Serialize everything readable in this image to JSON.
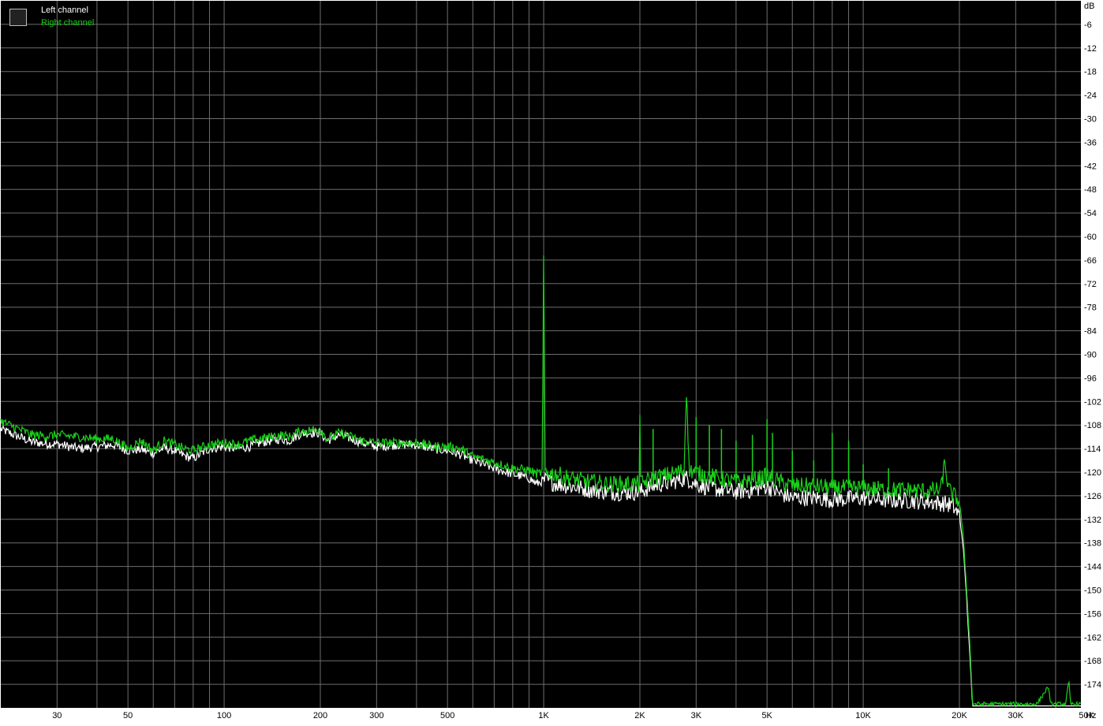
{
  "chart_data": {
    "type": "line",
    "x_axis": {
      "unit": "Hz",
      "scale": "log",
      "range": [
        20,
        48000
      ],
      "ticks": [
        {
          "value": 30,
          "label": "30"
        },
        {
          "value": 50,
          "label": "50"
        },
        {
          "value": 100,
          "label": "100"
        },
        {
          "value": 200,
          "label": "200"
        },
        {
          "value": 300,
          "label": "300"
        },
        {
          "value": 500,
          "label": "500"
        },
        {
          "value": 1000,
          "label": "1K"
        },
        {
          "value": 2000,
          "label": "2K"
        },
        {
          "value": 3000,
          "label": "3K"
        },
        {
          "value": 5000,
          "label": "5K"
        },
        {
          "value": 10000,
          "label": "10K"
        },
        {
          "value": 20000,
          "label": "20K"
        },
        {
          "value": 30000,
          "label": "30K"
        },
        {
          "value": 50000,
          "label": "50K"
        }
      ]
    },
    "y_axis": {
      "unit": "dB",
      "range": [
        -180,
        0
      ],
      "ticks": [
        -6,
        -12,
        -18,
        -24,
        -30,
        -36,
        -42,
        -48,
        -54,
        -60,
        -66,
        -72,
        -78,
        -84,
        -90,
        -96,
        -102,
        -108,
        -114,
        -120,
        -126,
        -132,
        -138,
        -144,
        -150,
        -156,
        -162,
        -168,
        -174
      ]
    },
    "grid": true,
    "legend_position": "top-left",
    "colors": {
      "background": "#000000",
      "grid": "#6e6e6e",
      "left": "#ffffff",
      "right": "#19d219",
      "axis_bg": "#ffffff"
    },
    "series": [
      {
        "name": "Left channel",
        "points": [
          [
            20,
            -109
          ],
          [
            22,
            -110.5
          ],
          [
            25,
            -112.3
          ],
          [
            28,
            -112.8
          ],
          [
            30,
            -112.8
          ],
          [
            35,
            -114
          ],
          [
            40,
            -113.5
          ],
          [
            45,
            -113
          ],
          [
            50,
            -114.5
          ],
          [
            55,
            -114.2
          ],
          [
            60,
            -115.2
          ],
          [
            65,
            -113.8
          ],
          [
            70,
            -114.5
          ],
          [
            75,
            -115.8
          ],
          [
            80,
            -116.5
          ],
          [
            90,
            -114
          ],
          [
            100,
            -113.5
          ],
          [
            110,
            -114
          ],
          [
            120,
            -113.5
          ],
          [
            130,
            -112.5
          ],
          [
            140,
            -112
          ],
          [
            150,
            -111.5
          ],
          [
            160,
            -112
          ],
          [
            170,
            -110.5
          ],
          [
            180,
            -110
          ],
          [
            200,
            -110
          ],
          [
            210,
            -112
          ],
          [
            230,
            -110.5
          ],
          [
            250,
            -111.5
          ],
          [
            270,
            -112.5
          ],
          [
            300,
            -113.5
          ],
          [
            350,
            -113
          ],
          [
            400,
            -113
          ],
          [
            450,
            -114
          ],
          [
            500,
            -114.5
          ],
          [
            550,
            -115.5
          ],
          [
            600,
            -117
          ],
          [
            700,
            -119
          ],
          [
            800,
            -120.5
          ],
          [
            900,
            -121.5
          ],
          [
            950,
            -123
          ],
          [
            1000,
            -122
          ],
          [
            1100,
            -123
          ],
          [
            1200,
            -123.5
          ],
          [
            1400,
            -124.5
          ],
          [
            1600,
            -125
          ],
          [
            1800,
            -125.2
          ],
          [
            2000,
            -125
          ],
          [
            2200,
            -123.5
          ],
          [
            2500,
            -122.5
          ],
          [
            2800,
            -121.5
          ],
          [
            3000,
            -123
          ],
          [
            3300,
            -124
          ],
          [
            3600,
            -124.5
          ],
          [
            4000,
            -125
          ],
          [
            4500,
            -124.5
          ],
          [
            5000,
            -123.5
          ],
          [
            5500,
            -125.5
          ],
          [
            6000,
            -126.5
          ],
          [
            7000,
            -126.5
          ],
          [
            8000,
            -127
          ],
          [
            9000,
            -126.8
          ],
          [
            10000,
            -126.5
          ],
          [
            12000,
            -127.2
          ],
          [
            14000,
            -127.2
          ],
          [
            16000,
            -127.5
          ],
          [
            18000,
            -128
          ],
          [
            19000,
            -128.5
          ],
          [
            20000,
            -131
          ],
          [
            20500,
            -138
          ],
          [
            21000,
            -150
          ],
          [
            21500,
            -165
          ],
          [
            22000,
            -180
          ],
          [
            48000,
            -180
          ]
        ]
      },
      {
        "name": "Right channel",
        "points": [
          [
            20,
            -107
          ],
          [
            22,
            -108.5
          ],
          [
            25,
            -110.5
          ],
          [
            28,
            -110.8
          ],
          [
            30,
            -110.5
          ],
          [
            35,
            -111
          ],
          [
            40,
            -111.5
          ],
          [
            45,
            -111.5
          ],
          [
            50,
            -114
          ],
          [
            55,
            -112
          ],
          [
            60,
            -114.5
          ],
          [
            65,
            -112
          ],
          [
            70,
            -113
          ],
          [
            75,
            -114
          ],
          [
            80,
            -114.5
          ],
          [
            90,
            -113
          ],
          [
            100,
            -112.5
          ],
          [
            110,
            -113
          ],
          [
            120,
            -112
          ],
          [
            130,
            -111.5
          ],
          [
            140,
            -111
          ],
          [
            150,
            -110.5
          ],
          [
            160,
            -111
          ],
          [
            170,
            -109.8
          ],
          [
            180,
            -109.5
          ],
          [
            200,
            -109
          ],
          [
            210,
            -111.5
          ],
          [
            230,
            -110
          ],
          [
            250,
            -111
          ],
          [
            270,
            -112
          ],
          [
            300,
            -112.5
          ],
          [
            350,
            -112.5
          ],
          [
            400,
            -112.5
          ],
          [
            450,
            -113.5
          ],
          [
            500,
            -113.5
          ],
          [
            550,
            -114
          ],
          [
            600,
            -116
          ],
          [
            700,
            -117.5
          ],
          [
            800,
            -119
          ],
          [
            900,
            -119.5
          ],
          [
            950,
            -120.5
          ],
          [
            990,
            -120
          ],
          [
            1000,
            -62
          ],
          [
            1010,
            -120
          ],
          [
            1100,
            -120.5
          ],
          [
            1200,
            -121.5
          ],
          [
            1400,
            -122.5
          ],
          [
            1600,
            -123
          ],
          [
            1800,
            -123
          ],
          [
            1990,
            -123
          ],
          [
            2000,
            -105
          ],
          [
            2010,
            -123
          ],
          [
            2200,
            -121.5
          ],
          [
            2500,
            -120.5
          ],
          [
            2750,
            -119.5
          ],
          [
            2800,
            -97.5
          ],
          [
            2850,
            -119.5
          ],
          [
            3000,
            -120
          ],
          [
            3100,
            -120.5
          ],
          [
            3200,
            -120.5
          ],
          [
            3500,
            -121.5
          ],
          [
            4000,
            -122.5
          ],
          [
            4500,
            -122
          ],
          [
            5000,
            -121
          ],
          [
            5500,
            -122.5
          ],
          [
            6000,
            -123.5
          ],
          [
            7000,
            -123.5
          ],
          [
            8000,
            -124
          ],
          [
            9000,
            -124
          ],
          [
            10000,
            -124
          ],
          [
            12000,
            -124.5
          ],
          [
            14000,
            -124.5
          ],
          [
            16000,
            -124.8
          ],
          [
            17500,
            -124.5
          ],
          [
            18000,
            -117.5
          ],
          [
            18500,
            -124.5
          ],
          [
            19000,
            -125.5
          ],
          [
            20000,
            -127.5
          ],
          [
            20500,
            -135
          ],
          [
            21000,
            -148
          ],
          [
            21500,
            -162
          ],
          [
            22000,
            -179
          ],
          [
            35000,
            -179
          ],
          [
            38000,
            -174.5
          ],
          [
            38500,
            -179
          ],
          [
            43000,
            -179
          ],
          [
            44000,
            -173
          ],
          [
            44500,
            -179
          ],
          [
            48000,
            -179
          ]
        ]
      }
    ],
    "annotations": {
      "spikes_right": [
        [
          1000,
          -62
        ],
        [
          2000,
          -105
        ],
        [
          2200,
          -109
        ],
        [
          2800,
          -97.5
        ],
        [
          3000,
          -106
        ],
        [
          3300,
          -108
        ],
        [
          3600,
          -109
        ],
        [
          4000,
          -112
        ],
        [
          4500,
          -110.5
        ],
        [
          5000,
          -106.5
        ],
        [
          5200,
          -110
        ],
        [
          6000,
          -114.5
        ],
        [
          7000,
          -117
        ],
        [
          8000,
          -110
        ],
        [
          9000,
          -112
        ],
        [
          10000,
          -118
        ],
        [
          12000,
          -119
        ],
        [
          18000,
          -117.5
        ],
        [
          38000,
          -174.5
        ],
        [
          44000,
          -173
        ]
      ]
    },
    "x_unit_label": "Hz",
    "y_unit_label": "dB"
  },
  "legend": {
    "left_label": "Left channel",
    "right_label": "Right channel"
  }
}
